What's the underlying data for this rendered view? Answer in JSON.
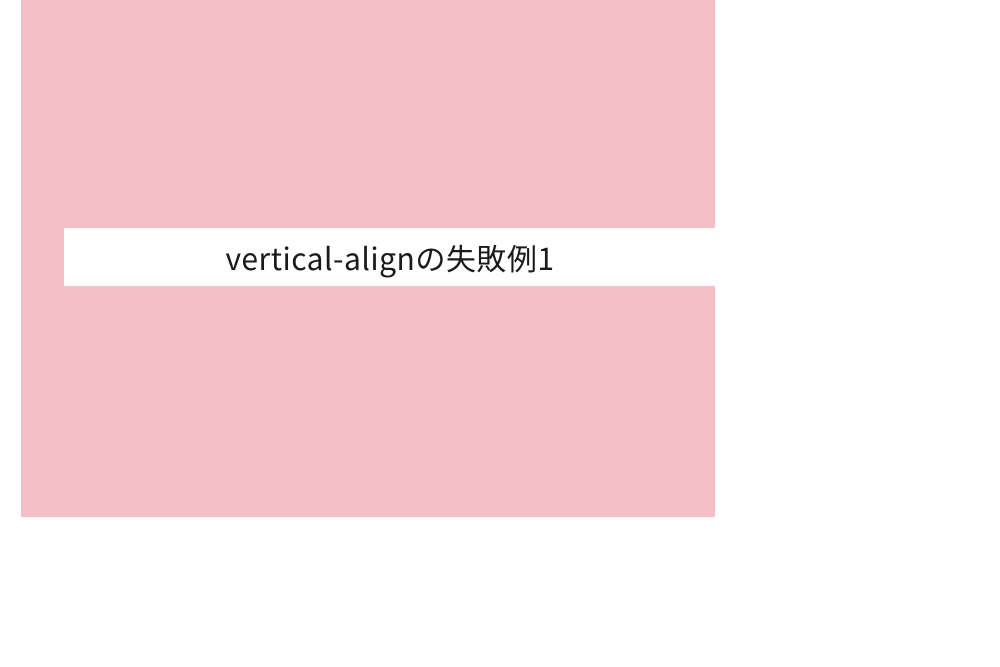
{
  "content": {
    "label_text": "vertical-alignの失敗例1"
  },
  "colors": {
    "pink_background": "#f4bfc6",
    "white": "#ffffff",
    "text": "#1a1a1a"
  }
}
